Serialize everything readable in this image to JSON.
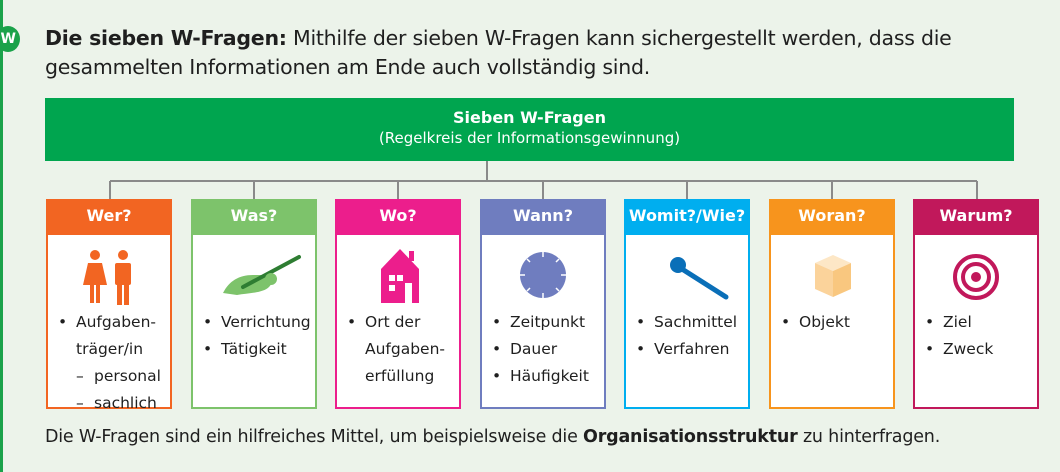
{
  "intro": {
    "bold": "Die sieben W-Fragen:",
    "text": " Mithilfe der sieben W-Fragen kann sichergestellt werden, dass die gesammelten Informationen am Ende auch vollständig sind."
  },
  "header": {
    "title": "Sieben W-Fragen",
    "subtitle": "(Regelkreis der Informationsgewinnung)"
  },
  "columns": [
    {
      "title": "Wer?",
      "color": "#f26522",
      "icon": "people-icon",
      "items": [
        "Aufgaben-",
        "träger/in"
      ],
      "subitems": [
        "personal",
        "sachlich"
      ]
    },
    {
      "title": "Was?",
      "color": "#7dc36b",
      "icon": "writing-hand-icon",
      "items": [
        "Verrichtung",
        "Tätigkeit"
      ]
    },
    {
      "title": "Wo?",
      "color": "#ec1e8c",
      "icon": "house-icon",
      "items": [
        "Ort der",
        "Aufgaben-",
        "erfüllung"
      ]
    },
    {
      "title": "Wann?",
      "color": "#6f7dbf",
      "icon": "clock-icon",
      "items": [
        "Zeitpunkt",
        "Dauer",
        "Häufigkeit"
      ]
    },
    {
      "title": "Womit?/Wie?",
      "color": "#00aeef",
      "icon": "microphone-icon",
      "items": [
        "Sachmittel",
        "Verfahren"
      ]
    },
    {
      "title": "Woran?",
      "color": "#f7941d",
      "icon": "cube-icon",
      "items": [
        "Objekt"
      ]
    },
    {
      "title": "Warum?",
      "color": "#c1185b",
      "icon": "target-icon",
      "items": [
        "Ziel",
        "Zweck"
      ]
    }
  ],
  "footer": {
    "text_before": "Die W-Fragen sind ein hilfreiches Mittel, um beispielsweise die ",
    "bold": "Organisationsstruktur",
    "text_after": " zu hinterfragen."
  }
}
